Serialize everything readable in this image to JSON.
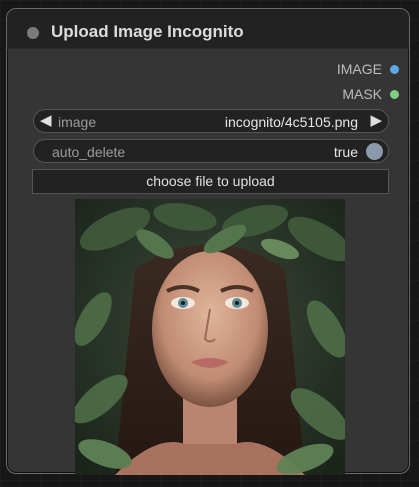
{
  "node": {
    "title": "Upload Image Incognito",
    "outputs": [
      {
        "label": "IMAGE",
        "color": "#5fa7e8"
      },
      {
        "label": "MASK",
        "color": "#7fcf7f"
      }
    ],
    "image_widget": {
      "label": "image",
      "value": "incognito/4c5105.png",
      "prev_arrow": "◀",
      "next_arrow": "▶"
    },
    "auto_delete_widget": {
      "label": "auto_delete",
      "value": "true"
    },
    "upload_button": "choose file to upload",
    "preview_image": {
      "description_icon": "portrait-image"
    }
  }
}
